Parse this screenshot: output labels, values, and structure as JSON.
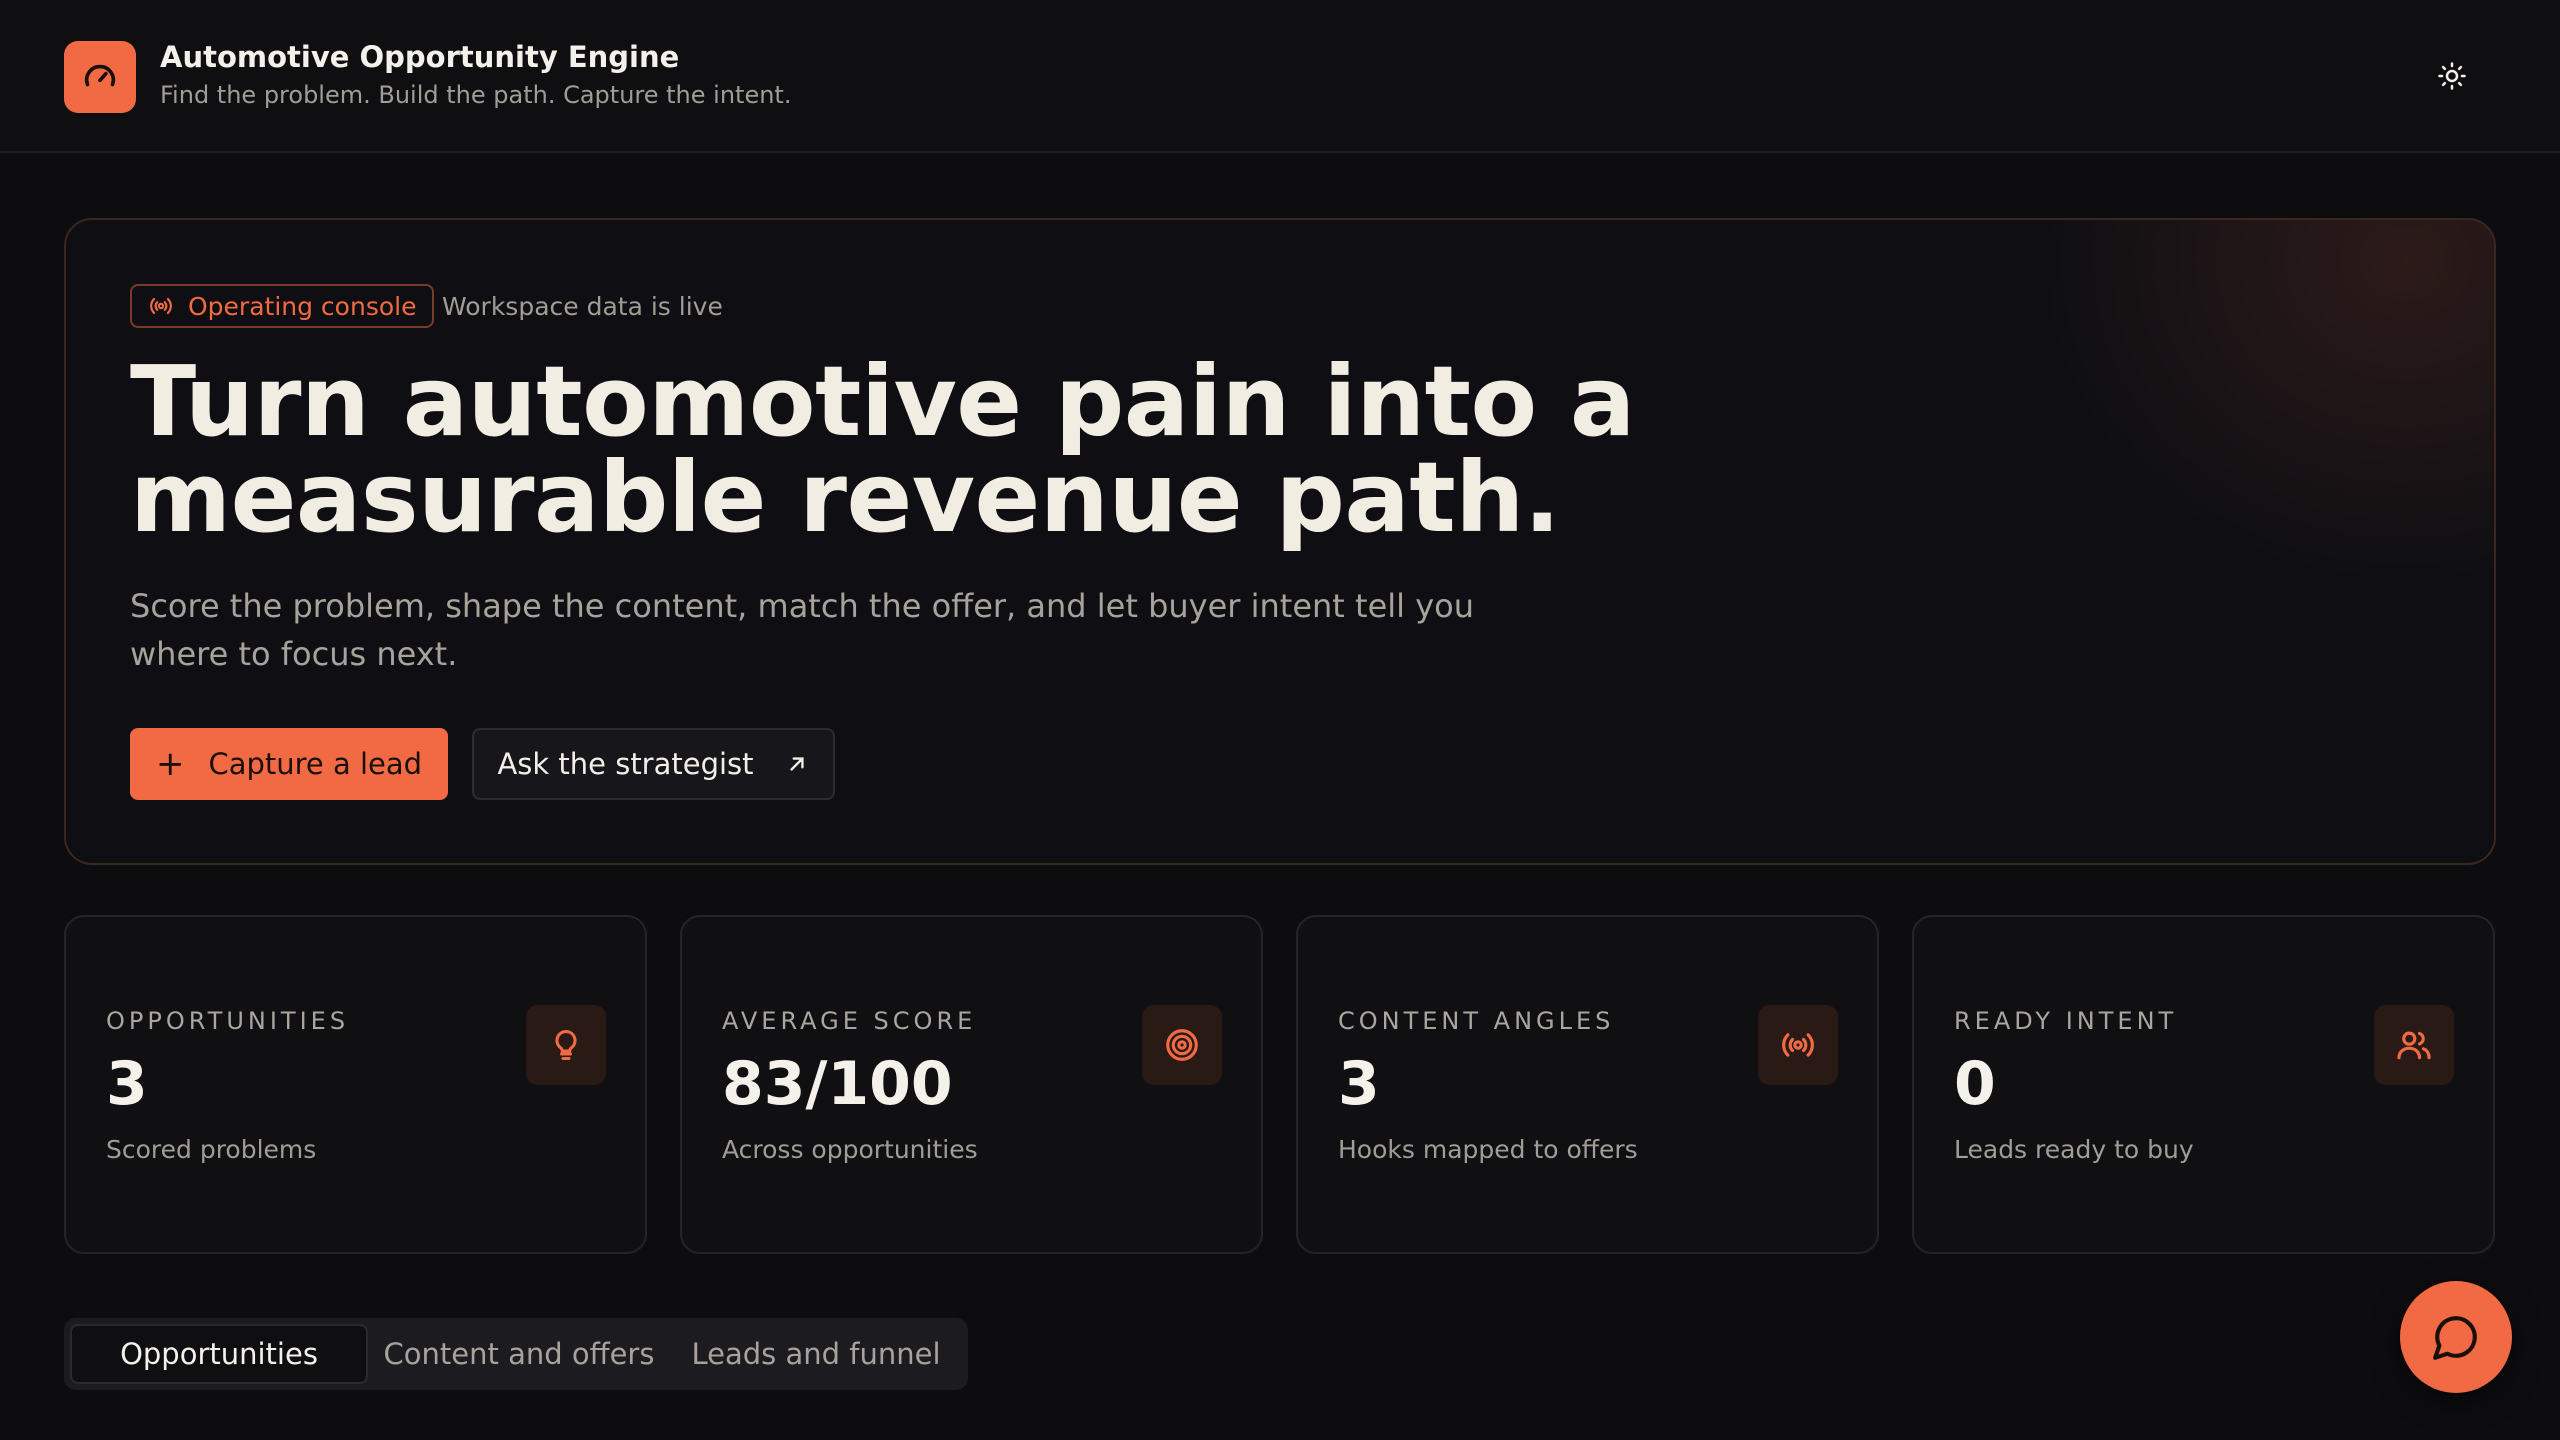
{
  "header": {
    "title": "Automotive Opportunity Engine",
    "subtitle": "Find the problem. Build the path. Capture the intent.",
    "logo_icon": "gauge-icon",
    "theme_icon": "sun-icon"
  },
  "hero": {
    "badge": "Operating console",
    "badge_note": "Workspace data is live",
    "title": "Turn automotive pain into a measurable revenue path.",
    "description": "Score the problem, shape the content, match the offer, and let buyer intent tell you where to focus next.",
    "primary_button": "Capture a lead",
    "secondary_button": "Ask the strategist"
  },
  "stats": [
    {
      "label": "OPPORTUNITIES",
      "value": "3",
      "desc": "Scored problems",
      "icon": "lightbulb-icon"
    },
    {
      "label": "AVERAGE SCORE",
      "value": "83/100",
      "desc": "Across opportunities",
      "icon": "target-icon"
    },
    {
      "label": "CONTENT ANGLES",
      "value": "3",
      "desc": "Hooks mapped to offers",
      "icon": "broadcast-icon"
    },
    {
      "label": "READY INTENT",
      "value": "0",
      "desc": "Leads ready to buy",
      "icon": "users-icon"
    }
  ],
  "tabs": [
    {
      "label": "Opportunities",
      "active": true
    },
    {
      "label": "Content and offers",
      "active": false
    },
    {
      "label": "Leads and funnel",
      "active": false
    }
  ],
  "colors": {
    "accent": "#f26a43",
    "background": "#0d0d10",
    "card": "#101013"
  }
}
